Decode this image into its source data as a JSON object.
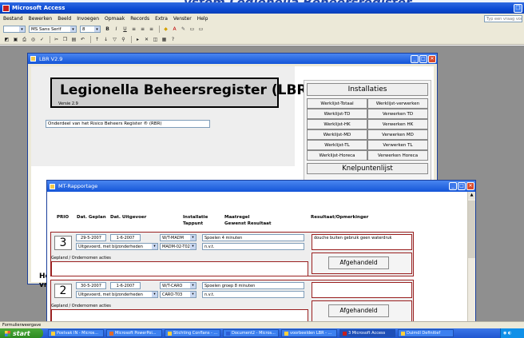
{
  "app": {
    "title": "Microsoft Access",
    "top_fragment": "ystem Legionella Beheersregister"
  },
  "menu": [
    "Bestand",
    "Bewerken",
    "Beeld",
    "Invoegen",
    "Opmaak",
    "Records",
    "Extra",
    "Venster",
    "Help"
  ],
  "help_box_placeholder": "Typ een vraag voor hulp",
  "toolbar": {
    "font_name": "MS Sans Serif",
    "font_size": "8",
    "bold": "B",
    "italic": "I",
    "underline": "U"
  },
  "lbr_window": {
    "title": "LBR V2.9",
    "banner_title": "Legionella Beheersregister (LBR)",
    "version": "Versie 2.9",
    "subtitle": "Onderdeel van het Risico Beheers Register ® (RBR)",
    "cut_label_line1": "Het",
    "cut_label_line2": "vra"
  },
  "installaties": {
    "title": "Installaties",
    "buttons": [
      "Werklijst-Totaal",
      "Werklijst-verwerken",
      "Werklijst-TD",
      "Verwerken TD",
      "Werklijst-HK",
      "Verwerken HK",
      "Werklijst-MD",
      "Verwerken MD",
      "Werklijst-TL",
      "Verwerken TL",
      "Werklijst-Horeca",
      "Verwerken Horeca"
    ],
    "knelpunten": "Knelpuntenlijst"
  },
  "mt_window": {
    "title": "MT-Rapportage",
    "headers": {
      "prio": "PRIO",
      "dat_gepland": "Dat. Geplan",
      "dat_uitgevoerd": "Dat. Uitgevoer",
      "installatie": "Installatie",
      "tappunt": "Tappunt",
      "maatregel": "Maatregel",
      "gewenst": "Gewenst Resultaat",
      "resultaat": "Resultaat/Opmerkinger"
    },
    "records": [
      {
        "prio": "3",
        "date_planned": "29-5-2007",
        "date_done": "1-6-2007",
        "installation": "W/T-MADM",
        "status": "Uitgevoerd, met bijzonderheden",
        "tappunt": "MADM-02-T02",
        "maatregel": "Spoelen 4 minuten",
        "gewenst": "n.v.t.",
        "resultaat": "douche buiten gebruik geen waterdruk",
        "gepland_label": "Gepland / Ondernomen acties",
        "button": "Afgehandeld"
      },
      {
        "prio": "2",
        "date_planned": "30-5-2007",
        "date_done": "1-6-2007",
        "installation": "W/T-CARO",
        "status": "Uitgevoerd, met bijzonderheden",
        "tappunt": "CARO-T03",
        "maatregel": "Spoelen groep 8 minuten",
        "gewenst": "n.v.t.",
        "resultaat": "",
        "gepland_label": "Gepland / Ondernomen acties",
        "button": "Afgehandeld"
      }
    ]
  },
  "statusbar": "Formulierweergave",
  "taskbar": {
    "start": "start",
    "tasks": [
      "Postvak IN - Micros...",
      "Microsoft PowerPoi...",
      "Stichting Conflans - ...",
      "Document2 - Micros...",
      "voorbeelden LBR - ...",
      "3 Microsoft Access",
      "Duimdl Definitief"
    ]
  }
}
